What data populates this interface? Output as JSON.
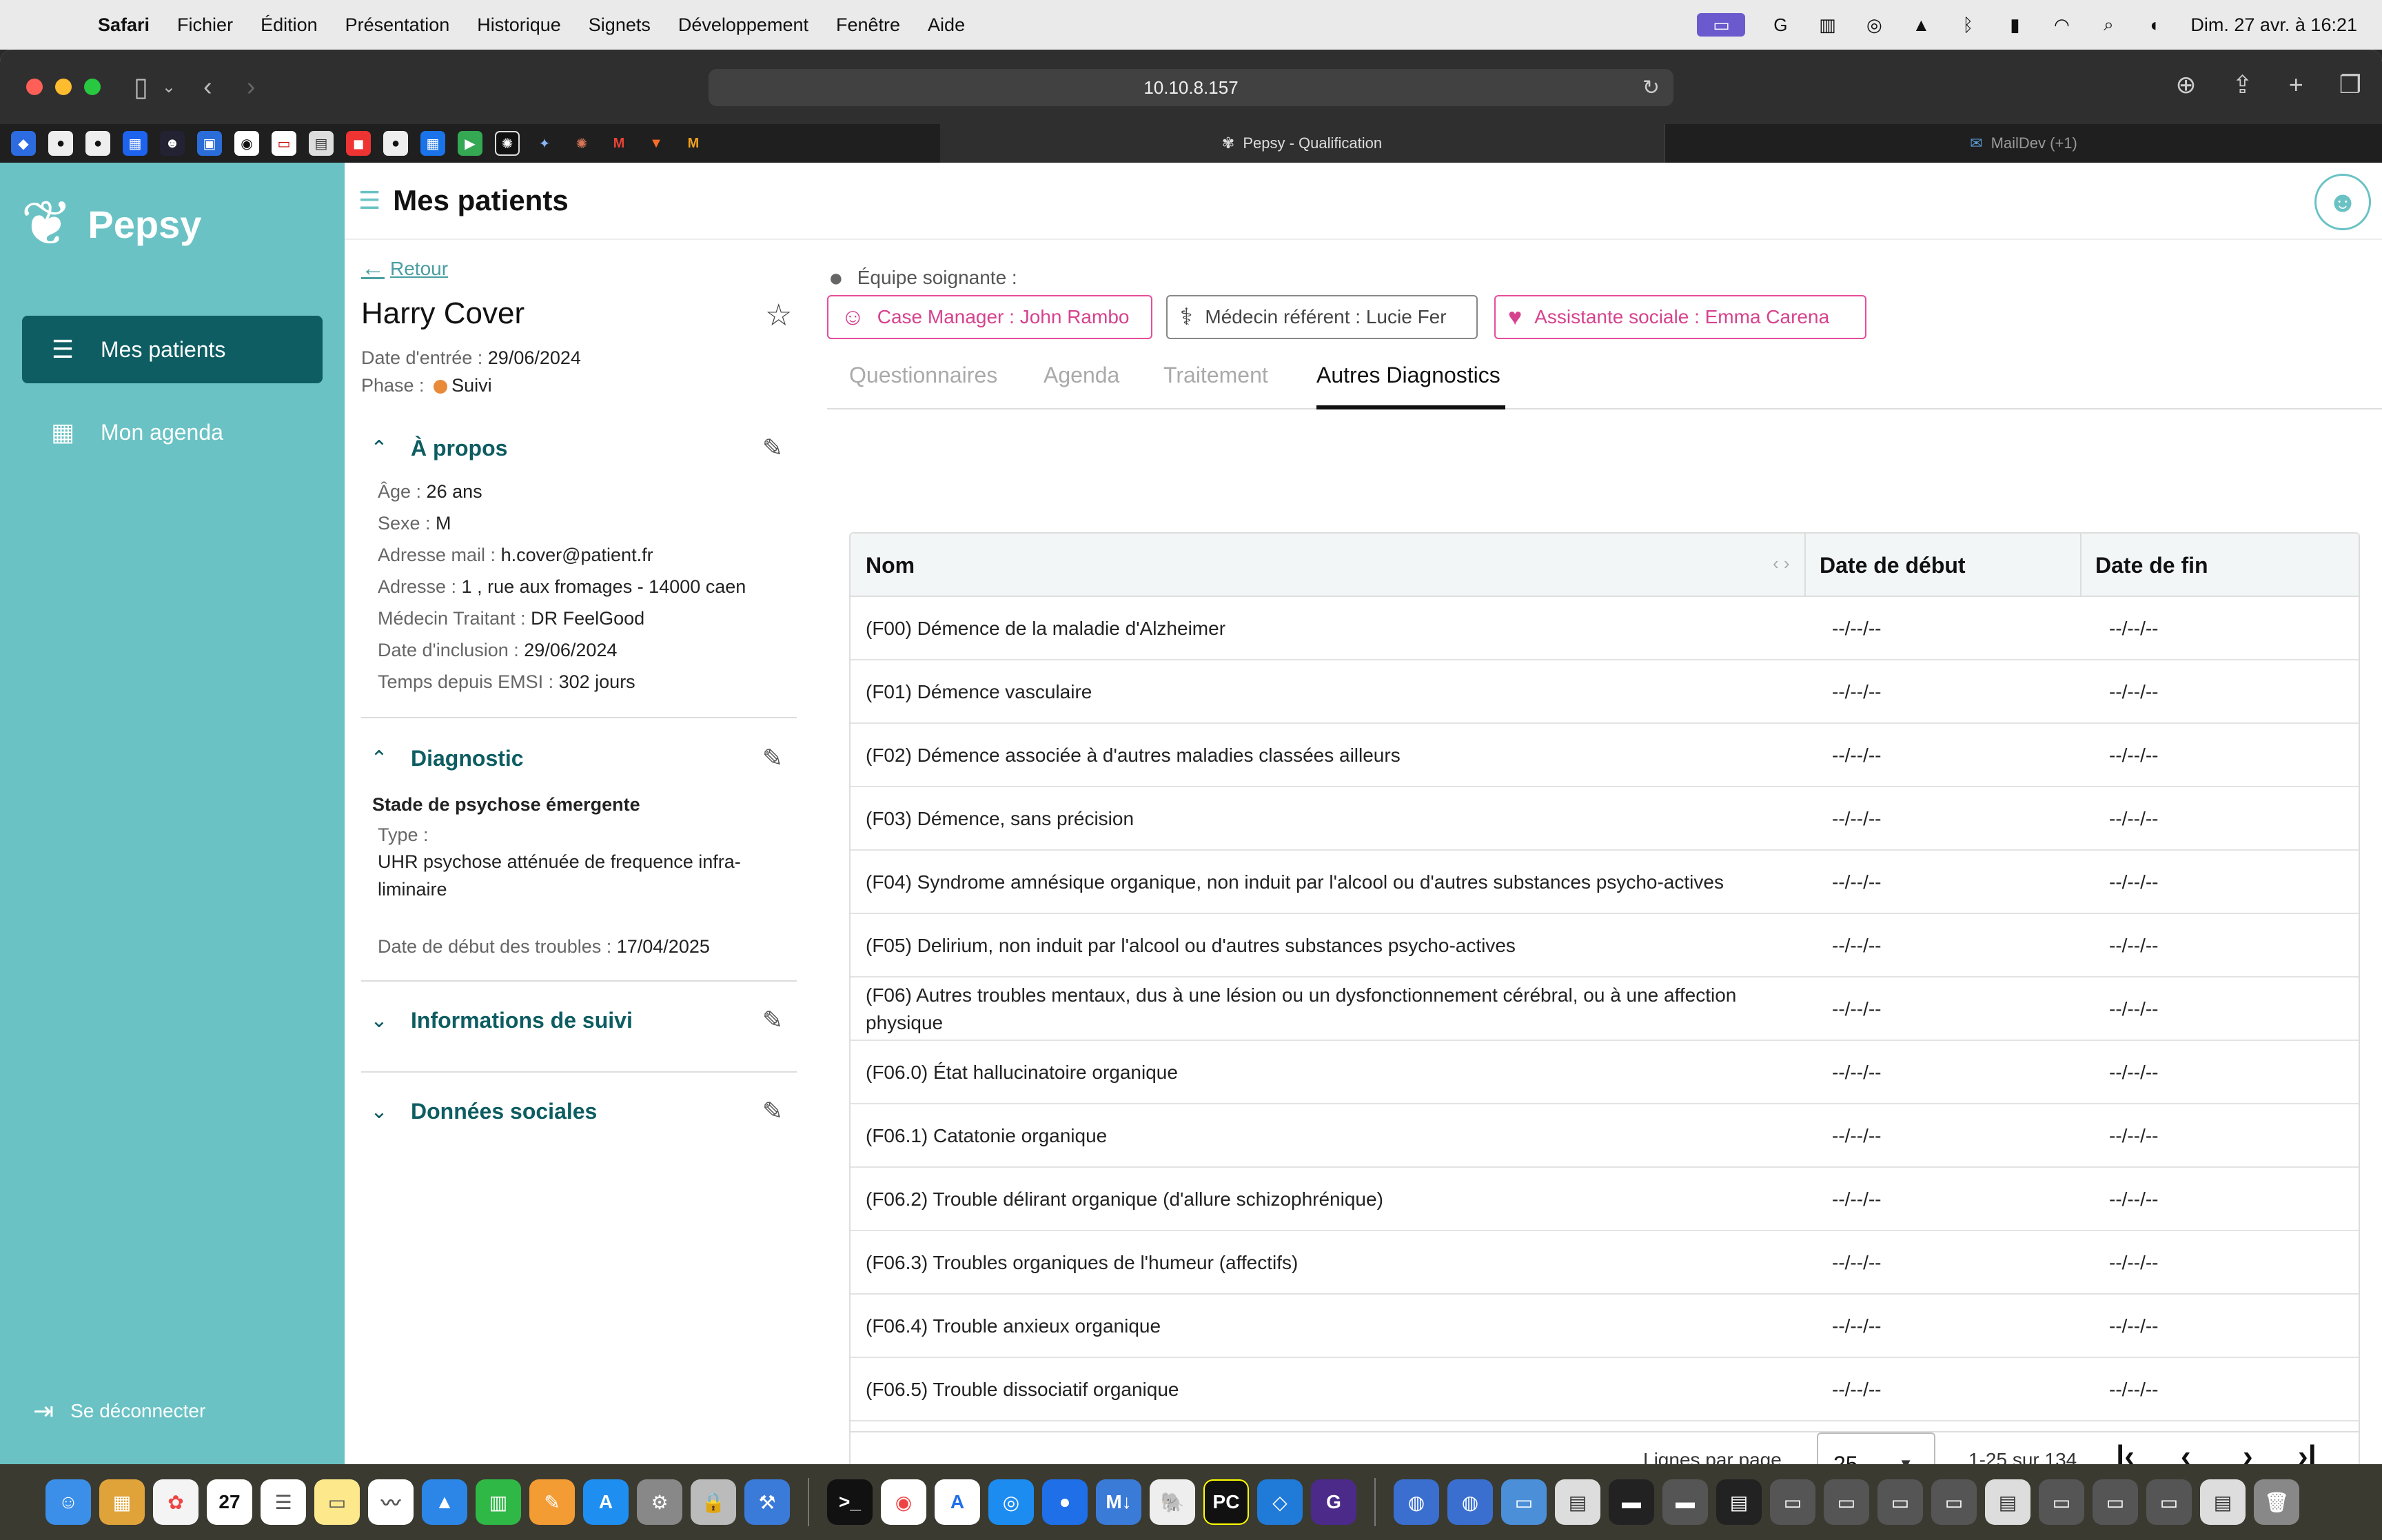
{
  "menubar": {
    "app_name": "Safari",
    "items": [
      "Fichier",
      "Édition",
      "Présentation",
      "Historique",
      "Signets",
      "Développement",
      "Fenêtre",
      "Aide"
    ],
    "clock": "Dim. 27 avr. à 16:21"
  },
  "browser": {
    "url": "10.10.8.157",
    "tabs": [
      {
        "label": "Pepsy - Qualification"
      },
      {
        "label": "MailDev (+1)"
      }
    ]
  },
  "sidebar": {
    "brand": "Pepsy",
    "nav": [
      {
        "label": "Mes patients"
      },
      {
        "label": "Mon agenda"
      }
    ],
    "logout_label": "Se déconnecter"
  },
  "header": {
    "title": "Mes patients"
  },
  "patient": {
    "back_label": "Retour",
    "name": "Harry Cover",
    "entry_label": "Date d'entrée : ",
    "entry_date": "29/06/2024",
    "phase_label": "Phase : ",
    "phase": "Suivi",
    "about": {
      "title": "À propos",
      "fields": [
        {
          "label": "Âge : ",
          "value": "26 ans"
        },
        {
          "label": "Sexe : ",
          "value": "M"
        },
        {
          "label": "Adresse mail : ",
          "value": "h.cover@patient.fr"
        },
        {
          "label": "Adresse : ",
          "value": "1 , rue aux fromages - 14000 caen"
        },
        {
          "label": "Médecin Traitant : ",
          "value": "DR FeelGood"
        },
        {
          "label": "Date d'inclusion : ",
          "value": "29/06/2024"
        },
        {
          "label": "Temps depuis EMSI : ",
          "value": "302 jours"
        }
      ]
    },
    "diagnostic": {
      "title": "Diagnostic",
      "stage": "Stade de psychose émergente",
      "type_label": "Type :",
      "type_value": "UHR psychose atténuée de frequence infra-liminaire",
      "start_label": "Date de début des troubles : ",
      "start_value": "17/04/2025"
    },
    "followup_title": "Informations de suivi",
    "social_title": "Données sociales"
  },
  "team": {
    "label": "Équipe soignante :",
    "chips": [
      {
        "label": "Case Manager : John Rambo"
      },
      {
        "label": "Médecin référent : Lucie Fer"
      },
      {
        "label": "Assistante sociale : Emma Carena"
      }
    ]
  },
  "tabs": [
    {
      "label": "Questionnaires"
    },
    {
      "label": "Agenda"
    },
    {
      "label": "Traitement"
    },
    {
      "label": "Autres Diagnostics"
    }
  ],
  "table": {
    "headers": [
      "Nom",
      "Date de début",
      "Date de fin"
    ],
    "rows": [
      {
        "name": "(F00) Démence de la maladie d'Alzheimer",
        "start": "--/--/--",
        "end": "--/--/--"
      },
      {
        "name": "(F01) Démence vasculaire",
        "start": "--/--/--",
        "end": "--/--/--"
      },
      {
        "name": "(F02) Démence associée à d'autres maladies classées ailleurs",
        "start": "--/--/--",
        "end": "--/--/--"
      },
      {
        "name": "(F03) Démence, sans précision",
        "start": "--/--/--",
        "end": "--/--/--"
      },
      {
        "name": "(F04) Syndrome amnésique organique, non induit par l'alcool ou d'autres substances psycho-actives",
        "start": "--/--/--",
        "end": "--/--/--"
      },
      {
        "name": "(F05) Delirium, non induit par l'alcool ou d'autres substances psycho-actives",
        "start": "--/--/--",
        "end": "--/--/--"
      },
      {
        "name": "(F06) Autres troubles mentaux, dus à une lésion ou un dysfonctionnement cérébral, ou à une affection physique",
        "start": "--/--/--",
        "end": "--/--/--"
      },
      {
        "name": "(F06.0) État hallucinatoire organique",
        "start": "--/--/--",
        "end": "--/--/--"
      },
      {
        "name": "(F06.1) Catatonie organique",
        "start": "--/--/--",
        "end": "--/--/--"
      },
      {
        "name": "(F06.2) Trouble délirant organique (d'allure schizophrénique)",
        "start": "--/--/--",
        "end": "--/--/--"
      },
      {
        "name": "(F06.3) Troubles organiques de l'humeur (affectifs)",
        "start": "--/--/--",
        "end": "--/--/--"
      },
      {
        "name": "(F06.4) Trouble anxieux organique",
        "start": "--/--/--",
        "end": "--/--/--"
      },
      {
        "name": "(F06.5) Trouble dissociatif organique",
        "start": "--/--/--",
        "end": "--/--/--"
      }
    ],
    "pagination": {
      "rows_per_page_label": "Lignes par page",
      "rows_per_page": "25",
      "range": "1-25 sur 134"
    }
  },
  "dock": {
    "calendar_day": "27"
  },
  "colors": {
    "sidebar": "#6ac2c4",
    "sidebar_active": "#0d5d62",
    "accent_pink": "#e64d9b",
    "phase_dot": "#e88a3a"
  }
}
